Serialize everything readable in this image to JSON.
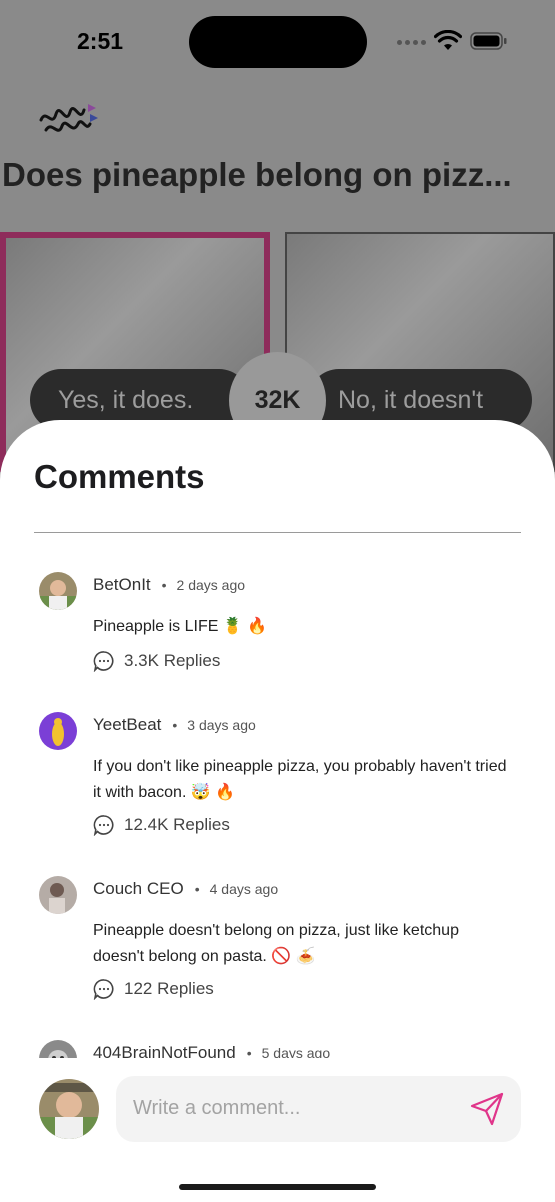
{
  "status": {
    "time": "2:51"
  },
  "question": {
    "title": "Does pineapple belong on pizz..."
  },
  "options": {
    "yes_label": "Yes, it does.",
    "no_label": "No, it doesn't",
    "vote_count": "32K"
  },
  "comments_sheet": {
    "title": "Comments",
    "items": [
      {
        "user": "BetOnIt",
        "time": "2 days ago",
        "text": "Pineapple is LIFE 🍍 🔥",
        "replies": "3.3K Replies"
      },
      {
        "user": "YeetBeat",
        "time": "3 days ago",
        "text": "If you don't like pineapple pizza, you probably haven't tried it with bacon. 🤯 🔥",
        "replies": "12.4K Replies"
      },
      {
        "user": "Couch CEO",
        "time": "4 days ago",
        "text": "Pineapple doesn't belong on pizza, just like ketchup doesn't belong on pasta. 🚫 🍝",
        "replies": "122 Replies"
      },
      {
        "user": "404BrainNotFound",
        "time": "5 days ago"
      }
    ]
  },
  "compose": {
    "placeholder": "Write a comment..."
  },
  "icons": {
    "reply": "chat-bubble-icon",
    "send": "paper-plane-icon",
    "logo": "app-logo-icon"
  },
  "colors": {
    "accent": "#e0358a",
    "selected_border": "#8e2c5b"
  }
}
